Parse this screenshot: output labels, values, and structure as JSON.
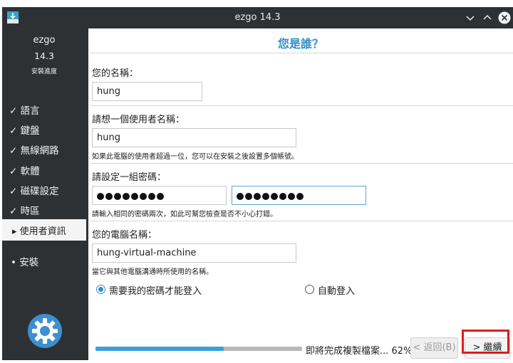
{
  "window": {
    "title": "ezgo 14.3"
  },
  "sidebar": {
    "app_name": "ezgo",
    "version": "14.3",
    "subtitle": "安裝進度",
    "items": [
      {
        "label": "✓ 語言"
      },
      {
        "label": "✓ 鍵盤"
      },
      {
        "label": "✓ 無線網路"
      },
      {
        "label": "✓ 軟體"
      },
      {
        "label": "✓ 磁碟設定"
      },
      {
        "label": "✓ 時區"
      },
      {
        "label": "▸ 使用者資訊"
      },
      {
        "label": "• 安裝"
      }
    ]
  },
  "main": {
    "heading": "您是誰？",
    "name_label": "您的名稱：",
    "name_value": "hung",
    "username_label": "請想一個使用者名稱：",
    "username_value": "hung",
    "username_hint": "如果此電腦的使用者超過一位，您可以在安裝之後設置多個帳號。",
    "password_label": "請設定一組密碼：",
    "password_hint": "請輸入相同的密碼兩次，如此可幫您檢查是否不小心打錯。",
    "computer_label": "您的電腦名稱：",
    "computer_value": "hung-virtual-machine",
    "computer_hint": "當它與其他電腦溝通時所使用的名稱。",
    "login_require": "需要我的密碼才能登入",
    "login_auto": "自動登入"
  },
  "footer": {
    "progress": 0.62,
    "status": "即將完成複製檔案... 62%",
    "back_label": "< 返回(B)",
    "continue_label": "> 繼續"
  },
  "colors": {
    "accent": "#2f8fc7",
    "sidebar": "#2e3134",
    "highlight": "#e01b1b"
  },
  "icons": {
    "app": "download-icon",
    "logo": "ezgo-gear-logo",
    "minimize": "chevron-down-icon",
    "maximize": "chevron-up-icon",
    "close": "close-icon"
  }
}
